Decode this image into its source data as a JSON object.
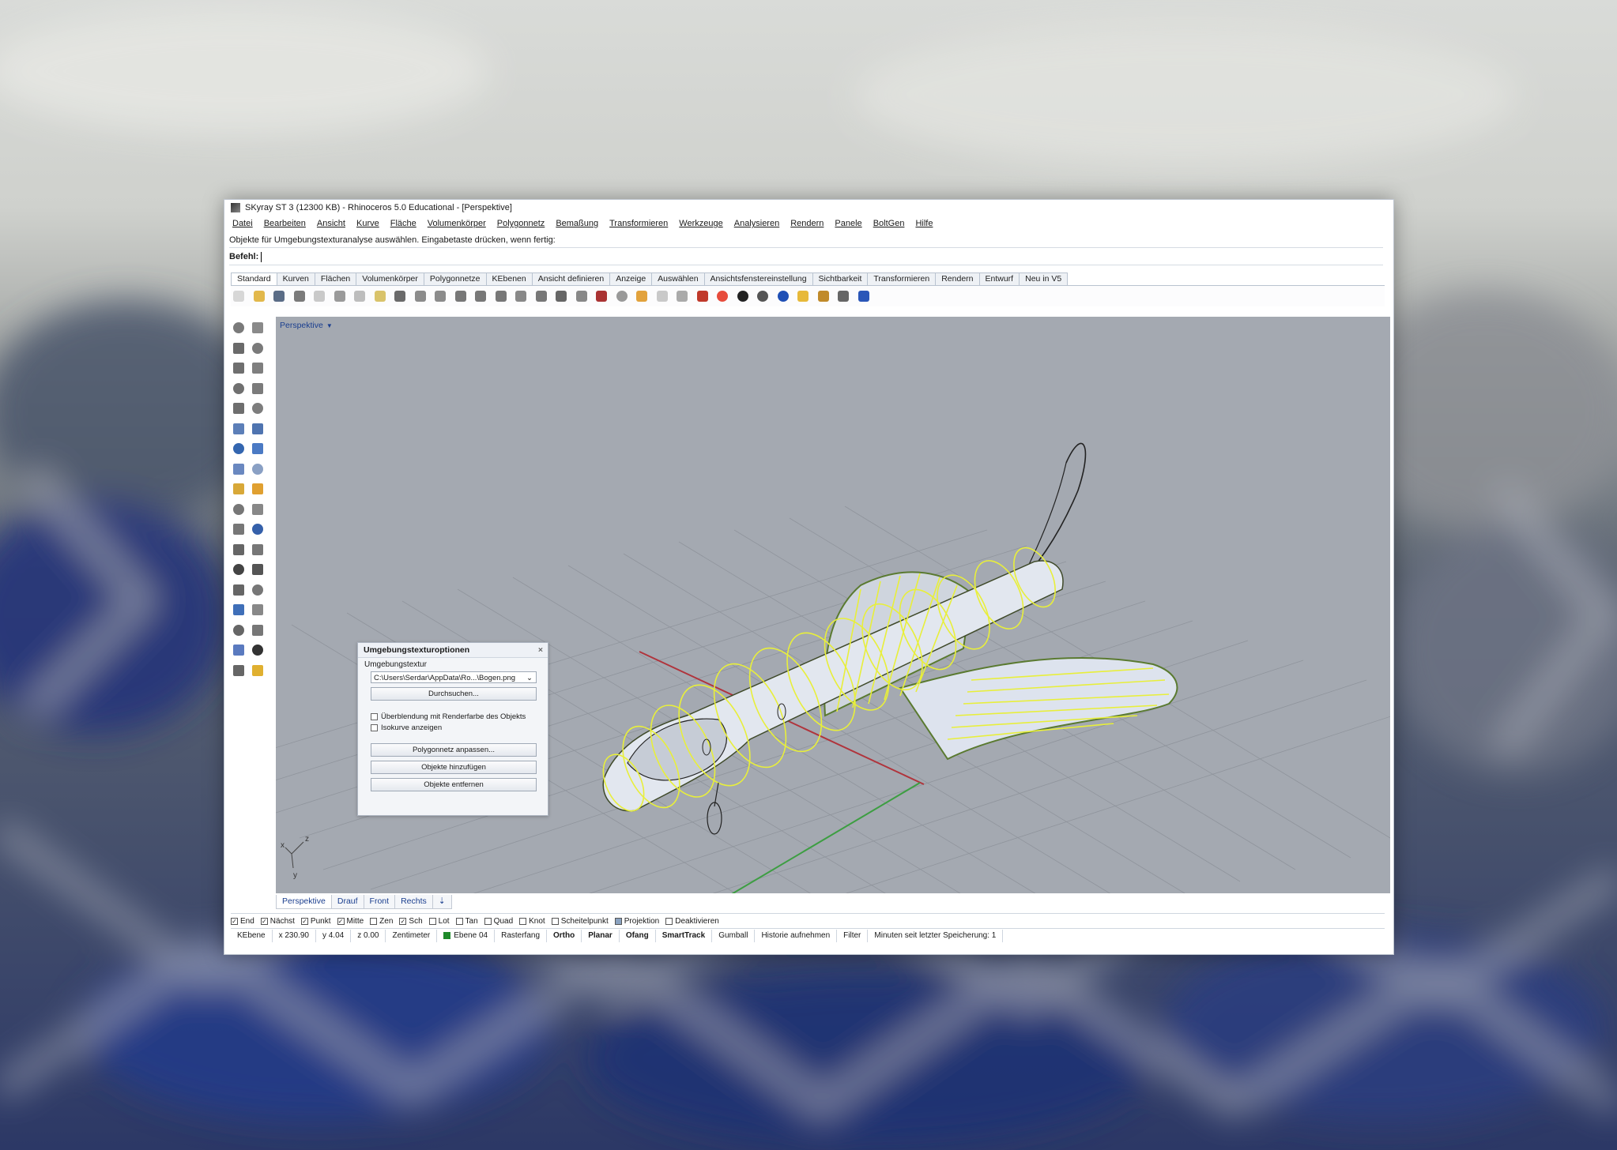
{
  "window": {
    "title": "SKyray ST 3 (12300 KB) - Rhinoceros 5.0 Educational - [Perspektive]"
  },
  "menu": [
    "Datei",
    "Bearbeiten",
    "Ansicht",
    "Kurve",
    "Fläche",
    "Volumenkörper",
    "Polygonnetz",
    "Bemaßung",
    "Transformieren",
    "Werkzeuge",
    "Analysieren",
    "Rendern",
    "Panele",
    "BoltGen",
    "Hilfe"
  ],
  "command_history": "Objekte für Umgebungstexturanalyse auswählen. Eingabetaste drücken, wenn fertig:",
  "command_prompt": "Befehl:",
  "toolbar_tabs": [
    "Standard",
    "Kurven",
    "Flächen",
    "Volumenkörper",
    "Polygonnetze",
    "KEbenen",
    "Ansicht definieren",
    "Anzeige",
    "Auswählen",
    "Ansichtsfenstereinstellung",
    "Sichtbarkeit",
    "Transformieren",
    "Rendern",
    "Entwurf",
    "Neu in V5"
  ],
  "toolbar_icons": [
    "new-icon",
    "open-icon",
    "save-icon",
    "print-icon",
    "import-icon",
    "cut-icon",
    "copy-icon",
    "paste-icon",
    "undo-icon",
    "pan-icon",
    "move-view-icon",
    "zoom-icon",
    "zoom-window-icon",
    "zoom-extents-icon",
    "zoom-selected-icon",
    "rotate-view-icon",
    "four-views-icon",
    "named-view-icon",
    "camera-icon",
    "target-icon",
    "osnap-icon",
    "lightbulb-icon",
    "lock-icon",
    "layer-icon",
    "color-wheel-icon",
    "sphere-shade-icon",
    "sphere-render-icon",
    "globe-icon",
    "filter-icon",
    "gear-icon",
    "block-icon",
    "help-icon"
  ],
  "viewport": {
    "label": "Perspektive",
    "axis_labels": {
      "x": "x",
      "y": "y",
      "z": "z"
    }
  },
  "dialog": {
    "title": "Umgebungstexturoptionen",
    "close": "×",
    "group_label": "Umgebungstextur",
    "texture_path": "C:\\Users\\Serdar\\AppData\\Ro...\\Bogen.png",
    "browse": "Durchsuchen...",
    "check_blend": "Überblendung mit Renderfarbe des Objekts",
    "check_isocurves": "Isokurve anzeigen",
    "btn_adjust_mesh": "Polygonnetz anpassen...",
    "btn_add_objects": "Objekte hinzufügen",
    "btn_remove_objects": "Objekte entfernen"
  },
  "viewport_tabs": [
    "Perspektive",
    "Drauf",
    "Front",
    "Rechts"
  ],
  "osnaps": [
    {
      "label": "End",
      "on": true
    },
    {
      "label": "Nächst",
      "on": true
    },
    {
      "label": "Punkt",
      "on": true
    },
    {
      "label": "Mitte",
      "on": true
    },
    {
      "label": "Zen",
      "on": false
    },
    {
      "label": "Sch",
      "on": true
    },
    {
      "label": "Lot",
      "on": false
    },
    {
      "label": "Tan",
      "on": false
    },
    {
      "label": "Quad",
      "on": false
    },
    {
      "label": "Knot",
      "on": false
    },
    {
      "label": "Scheitelpunkt",
      "on": false
    },
    {
      "label": "Projektion",
      "on": false
    },
    {
      "label": "Deaktivieren",
      "on": false
    }
  ],
  "statusbar": {
    "cplane": "KEbene",
    "x": "x 230.90",
    "y": "y 4.04",
    "z": "z 0.00",
    "units": "Zentimeter",
    "layer": "Ebene 04",
    "layer_color": "#1f8a2a",
    "toggles": [
      {
        "label": "Rasterfang",
        "bold": false
      },
      {
        "label": "Ortho",
        "bold": true
      },
      {
        "label": "Planar",
        "bold": true
      },
      {
        "label": "Ofang",
        "bold": true
      },
      {
        "label": "SmartTrack",
        "bold": true
      },
      {
        "label": "Gumball",
        "bold": false
      },
      {
        "label": "Historie aufnehmen",
        "bold": false
      },
      {
        "label": "Filter",
        "bold": false
      }
    ],
    "save_info": "Minuten seit letzter Speicherung: 1"
  },
  "colors": {
    "viewport_bg": "#a4a9b1",
    "grid": "#8f949c",
    "model_surface": "#d7dde8",
    "isocurves": "#e8ef3a",
    "x_axis": "#b0343c",
    "y_axis": "#3d9e42"
  }
}
